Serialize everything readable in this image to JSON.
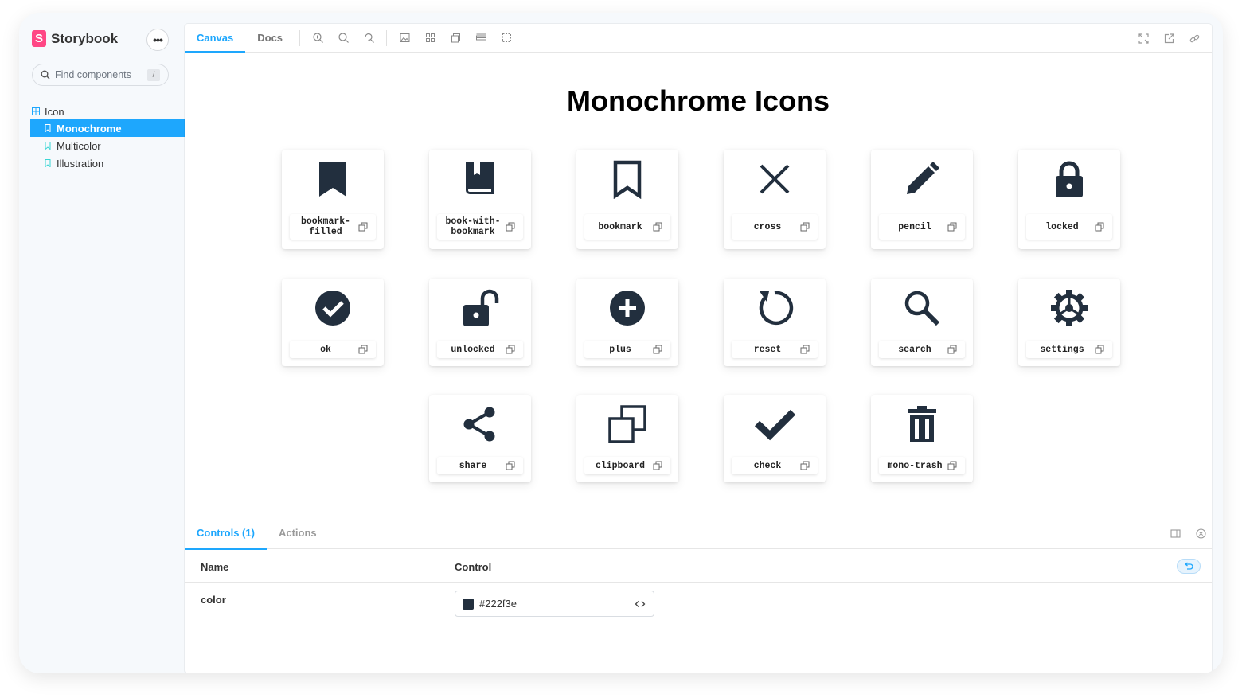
{
  "sidebar": {
    "brand": "Storybook",
    "menu_label": "•••",
    "search_placeholder": "Find components",
    "search_shortcut": "/",
    "group": "Icon",
    "items": [
      {
        "label": "Monochrome",
        "active": true
      },
      {
        "label": "Multicolor",
        "active": false
      },
      {
        "label": "Illustration",
        "active": false
      }
    ]
  },
  "toolbar": {
    "tabs": [
      {
        "label": "Canvas",
        "active": true
      },
      {
        "label": "Docs",
        "active": false
      }
    ],
    "tools": [
      "zoom-in-icon",
      "zoom-out-icon",
      "zoom-reset-icon",
      "background-icon",
      "grid-icon",
      "viewport-icon",
      "measure-icon",
      "outline-icon"
    ],
    "right_tools": [
      "fullscreen-icon",
      "open-new-tab-icon",
      "copy-link-icon"
    ]
  },
  "canvas": {
    "title": "Monochrome Icons",
    "icons": [
      {
        "label": "bookmark-filled",
        "icon": "bookmark-filled-icon"
      },
      {
        "label": "book-with-bookmark",
        "icon": "book-with-bookmark-icon"
      },
      {
        "label": "bookmark",
        "icon": "bookmark-icon"
      },
      {
        "label": "cross",
        "icon": "cross-icon"
      },
      {
        "label": "pencil",
        "icon": "pencil-icon"
      },
      {
        "label": "locked",
        "icon": "locked-icon"
      },
      {
        "label": "ok",
        "icon": "ok-icon"
      },
      {
        "label": "unlocked",
        "icon": "unlocked-icon"
      },
      {
        "label": "plus",
        "icon": "plus-icon"
      },
      {
        "label": "reset",
        "icon": "reset-icon"
      },
      {
        "label": "search",
        "icon": "search-icon"
      },
      {
        "label": "settings",
        "icon": "settings-icon"
      },
      {
        "label": "share",
        "icon": "share-icon"
      },
      {
        "label": "clipboard",
        "icon": "clipboard-icon"
      },
      {
        "label": "check",
        "icon": "check-icon"
      },
      {
        "label": "mono-trash",
        "icon": "trash-icon"
      }
    ]
  },
  "addons": {
    "tabs": [
      {
        "label": "Controls (1)",
        "active": true
      },
      {
        "label": "Actions",
        "active": false
      }
    ],
    "table": {
      "col_name": "Name",
      "col_control": "Control",
      "rows": [
        {
          "name": "color",
          "value": "#222f3e"
        }
      ]
    }
  },
  "colors": {
    "accent": "#1ea7fd",
    "brand": "#ff4785",
    "icon": "#222f3e"
  }
}
